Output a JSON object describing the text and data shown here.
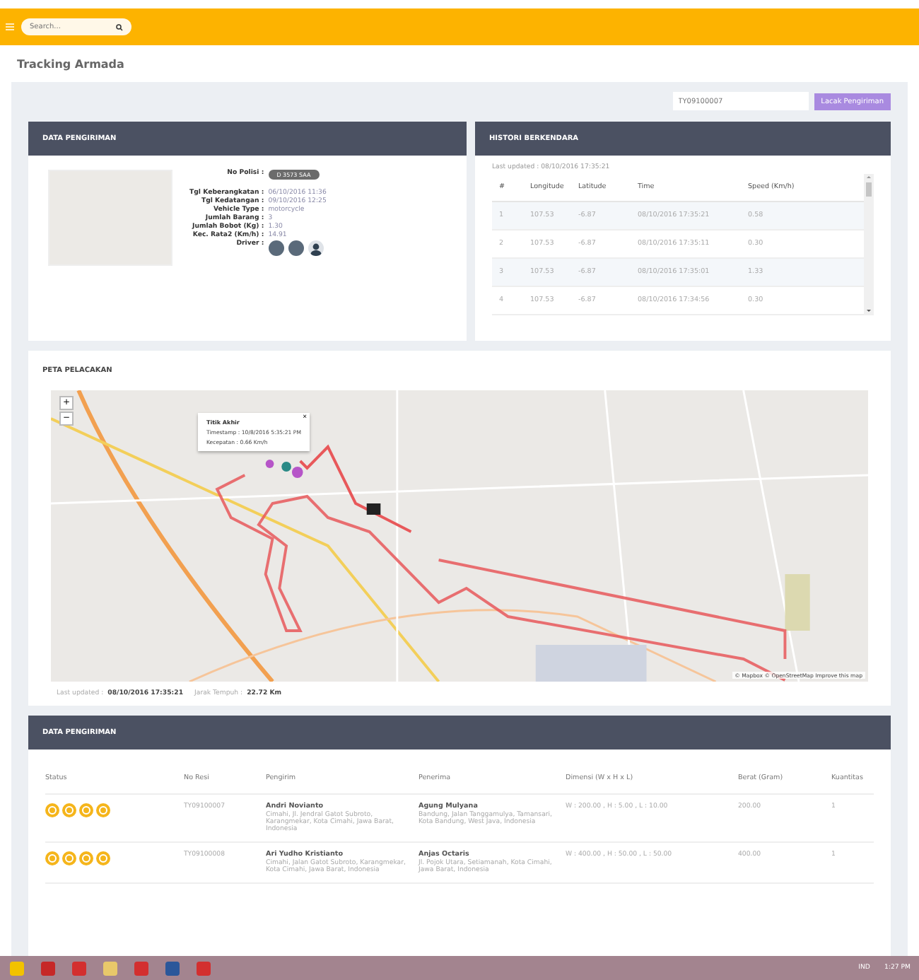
{
  "topbar": {
    "search_placeholder": "Search..."
  },
  "page_title": "Tracking Armada",
  "tracking_search": {
    "value": "TY09100007",
    "button": "Lacak Pengiriman"
  },
  "vehicle_card": {
    "title": "DATA PENGIRIMAN",
    "plate_label": "No Polisi :",
    "plate": "D 3573 SAA",
    "fields": [
      {
        "label": "Tgl Keberangkatan :",
        "value": "06/10/2016 11:36"
      },
      {
        "label": "Tgl Kedatangan :",
        "value": "09/10/2016 12:25"
      },
      {
        "label": "Vehicle Type :",
        "value": "motorcycle"
      },
      {
        "label": "Jumlah Barang :",
        "value": "3"
      },
      {
        "label": "Jumlah Bobot (Kg) :",
        "value": "1.30"
      },
      {
        "label": "Kec. Rata2 (Km/h) :",
        "value": "14.91"
      }
    ],
    "driver_label": "Driver :",
    "drivers": [
      {
        "kind": "photo"
      },
      {
        "kind": "photo"
      },
      {
        "kind": "silhouette"
      }
    ]
  },
  "history_card": {
    "title": "HISTORI BERKENDARA",
    "last_updated_label": "Last updated :",
    "last_updated": "08/10/2016 17:35:21",
    "columns": [
      "#",
      "Longitude",
      "Latitude",
      "Time",
      "Speed (Km/h)"
    ],
    "rows": [
      [
        "1",
        "107.53",
        "-6.87",
        "08/10/2016 17:35:21",
        "0.58"
      ],
      [
        "2",
        "107.53",
        "-6.87",
        "08/10/2016 17:35:11",
        "0.30"
      ],
      [
        "3",
        "107.53",
        "-6.87",
        "08/10/2016 17:35:01",
        "1.33"
      ],
      [
        "4",
        "107.53",
        "-6.87",
        "08/10/2016 17:34:56",
        "0.30"
      ]
    ]
  },
  "map_card": {
    "title": "PETA PELACAKAN",
    "zoom": [
      "+",
      "−"
    ],
    "popup": {
      "title": "Titik Akhir",
      "close": "×",
      "lines": [
        "Timestamp : 10/8/2016 5:35:21 PM",
        "Kecepatan : 0.66 Km/h"
      ]
    },
    "attribution": "© Mapbox © OpenStreetMap Improve this map",
    "footer": [
      {
        "label": "Last updated :",
        "value": "08/10/2016 17:35:21"
      },
      {
        "label": "Jarak Tempuh :",
        "value": "22.72 Km"
      }
    ]
  },
  "orders_card": {
    "title": "DATA PENGIRIMAN",
    "columns": [
      "Status",
      "No Resi",
      "Pengirim",
      "Penerima",
      "Dimensi (W x H x L)",
      "Berat (Gram)",
      "Kuantitas"
    ],
    "rows": [
      {
        "resi": "TY09100007",
        "sender": "Andri Novianto",
        "sender_address": "Cimahi, Jl. Jendral Gatot Subroto, Karangmekar, Kota Cimahi, Jawa Barat, Indonesia",
        "receiver": "Agung Mulyana",
        "receiver_address": "Bandung, Jalan Tanggamulya, Tamansari, Kota Bandung, West Java, Indonesia",
        "dimension": "W : 200.00 , H : 5.00 , L : 10.00",
        "weight": "200.00",
        "qty": "1"
      },
      {
        "resi": "TY09100008",
        "sender": "Ari Yudho Kristianto",
        "sender_address": "Cimahi, Jalan Gatot Subroto, Karangmekar, Kota Cimahi, Jawa Barat, Indonesia",
        "receiver": "Anjas Octaris",
        "receiver_address": "Jl. Pojok Utara, Setiamanah, Kota Cimahi, Jawa Barat, Indonesia",
        "dimension": "W : 400.00 , H : 50.00 , L : 50.00",
        "weight": "400.00",
        "qty": "1"
      }
    ]
  },
  "taskbar": {
    "language": "IND",
    "clock": "1:27 PM"
  }
}
